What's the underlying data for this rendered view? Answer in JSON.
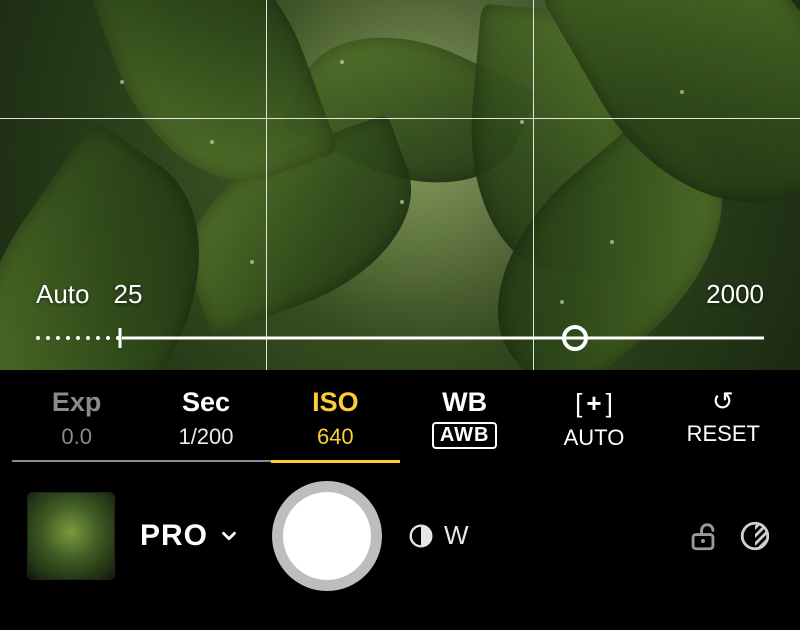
{
  "iso_scale": {
    "auto_label": "Auto",
    "min_label": "25",
    "max_label": "2000",
    "handle_percent": 74
  },
  "params": {
    "exp": {
      "label": "Exp",
      "value": "0.0"
    },
    "sec": {
      "label": "Sec",
      "value": "1/200"
    },
    "iso": {
      "label": "ISO",
      "value": "640"
    },
    "wb": {
      "label": "WB",
      "badge": "AWB"
    },
    "focus": {
      "value": "AUTO",
      "icon": "[+]"
    },
    "reset": {
      "label": "RESET"
    }
  },
  "bottom": {
    "mode_label": "PRO",
    "lens_label": "W"
  }
}
